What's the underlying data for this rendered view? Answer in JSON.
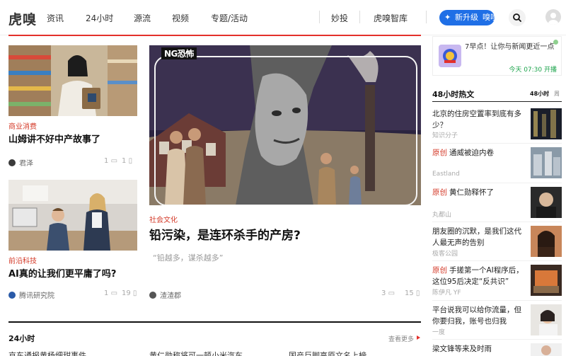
{
  "brand": {
    "logo": "虎嗅"
  },
  "nav": {
    "items": [
      "资讯",
      "24小时",
      "源流",
      "视频",
      "专题/活动"
    ],
    "right_items": [
      "妙投",
      "虎嗅智库"
    ],
    "upgrade_label": "新升级",
    "upgrade_sub": "嗅嗅会"
  },
  "articles": [
    {
      "category": "商业消费",
      "title": "山姆讲不好中产故事了",
      "author": "君泽",
      "comments": "1",
      "favorites": "1"
    },
    {
      "category": "前沿科技",
      "title": "AI真的让我们更平庸了吗?",
      "author": "腾讯研究院",
      "comments": "1",
      "favorites": "19"
    }
  ],
  "feature": {
    "badge": "NG恐怖",
    "category": "社会文化",
    "title": "铅污染，是连环杀手的产房?",
    "quote": "“铅越多，谋杀越多”",
    "author": "渣渣郡",
    "comments": "3",
    "favorites": "15"
  },
  "sidebar": {
    "promo": {
      "text": "7早点！让你与新闻更近一点",
      "time": "今天 07:30 开播"
    },
    "hot_title": "48小时热文",
    "hot_tabs": [
      "48小时",
      "周"
    ],
    "hot_items": [
      {
        "original": "",
        "title": "北京的住房空置率到底有多少？",
        "source": "知识分子"
      },
      {
        "original": "原创",
        "title": "通威被迫内卷",
        "source": "Eastland"
      },
      {
        "original": "原创",
        "title": "黄仁勋释怀了",
        "source": "丸都山"
      },
      {
        "original": "",
        "title": "朋友圈的沉默，是我们这代人最无声的告别",
        "source": "极客公园"
      },
      {
        "original": "原创",
        "title": "手搓第一个AI程序后，这位95后决定“反共识”",
        "source": "陈伊凡 YF"
      },
      {
        "original": "",
        "title": "平台说我可以给你流量，但你要归我，账号也归我",
        "source": "一度"
      },
      {
        "original": "",
        "title": "梁文锋等来及时雨",
        "source": ""
      }
    ]
  },
  "bottom": {
    "section_title": "24小时",
    "more_label": "查看更多",
    "peek": [
      "京东通报黄杨细甜事件",
      "黄仁勋称将可一顿小米汽车",
      "国产巨脚高原文名上榜"
    ]
  },
  "colors": {
    "accent": "#e3302b",
    "brand_blue": "#1f6fe6",
    "category": "#d43b2a"
  }
}
